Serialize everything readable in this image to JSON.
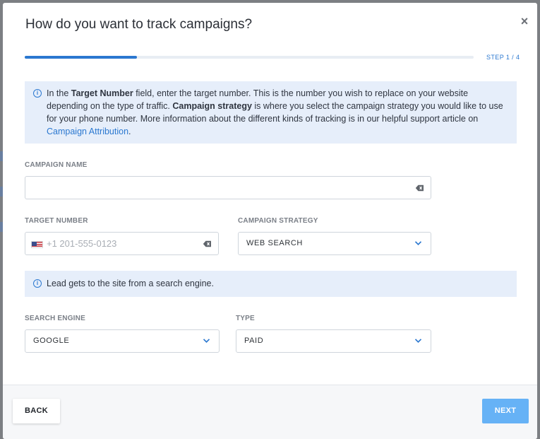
{
  "modal": {
    "title": "How do you want to track campaigns?",
    "close_label": "×",
    "step_label": "STEP 1 / 4",
    "progress_fraction": 0.25
  },
  "info_main": {
    "part1": "In the ",
    "bold1": "Target Number",
    "part2": " field, enter the target number. This is the number you wish to replace on your website depending on the type of traffic. ",
    "bold2": "Campaign strategy",
    "part3": " is where you select the campaign strategy you would like to use for your phone number. More information about the different kinds of tracking is in our helpful support article on ",
    "link": "Campaign Attribution",
    "part4": "."
  },
  "campaign_name": {
    "label": "CAMPAIGN NAME",
    "value": "",
    "placeholder": ""
  },
  "target_number": {
    "label": "TARGET NUMBER",
    "value": "",
    "placeholder": "+1 201-555-0123"
  },
  "campaign_strategy": {
    "label": "CAMPAIGN STRATEGY",
    "selected": "WEB SEARCH"
  },
  "info_sub": {
    "text": "Lead gets to the site from a search engine."
  },
  "search_engine": {
    "label": "SEARCH ENGINE",
    "selected": "GOOGLE"
  },
  "type": {
    "label": "TYPE",
    "selected": "PAID"
  },
  "footer": {
    "back_label": "BACK",
    "next_label": "NEXT"
  },
  "icons": {
    "info": "info-icon",
    "eraser": "eraser-icon",
    "chevron": "chevron-down-icon",
    "flag": "us-flag-icon",
    "close": "close-icon"
  },
  "colors": {
    "accent": "#2b78d0",
    "info_bg": "#e6eefa",
    "next_button": "#66b2f6"
  }
}
